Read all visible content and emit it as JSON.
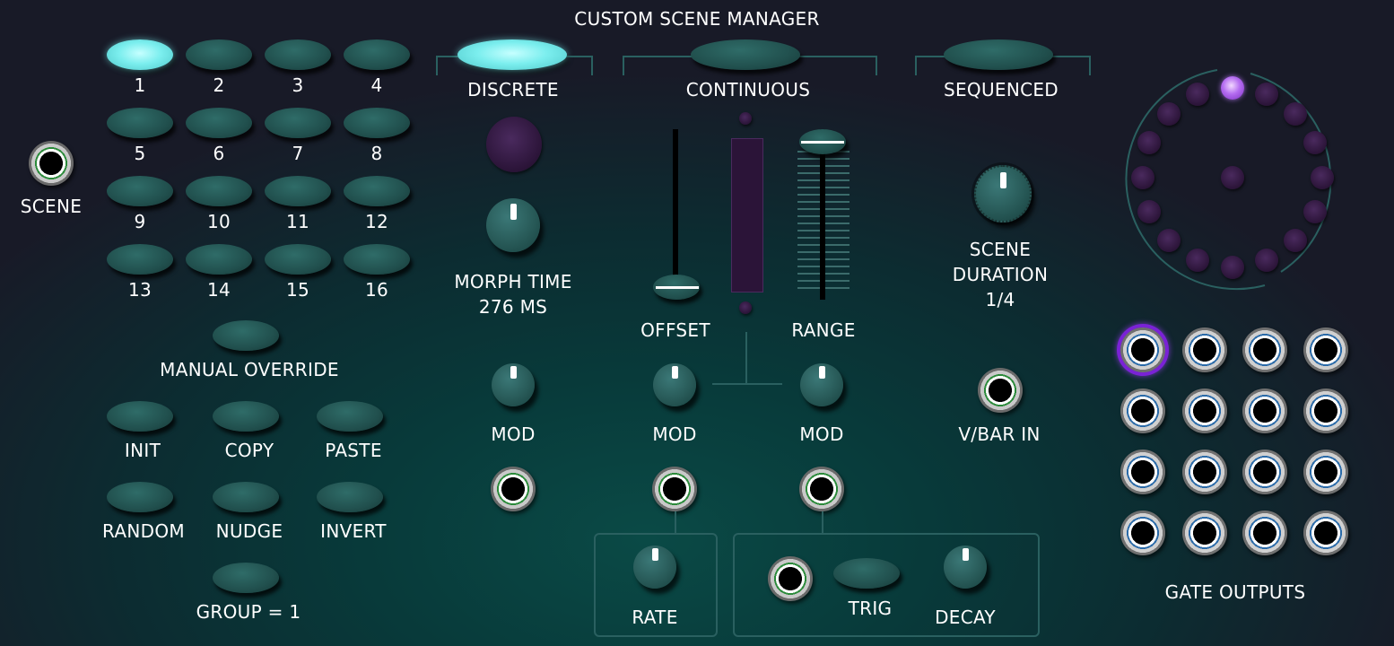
{
  "title": "CUSTOM SCENE MANAGER",
  "scene_input": {
    "label": "SCENE"
  },
  "scenes": {
    "buttons": [
      "1",
      "2",
      "3",
      "4",
      "5",
      "6",
      "7",
      "8",
      "9",
      "10",
      "11",
      "12",
      "13",
      "14",
      "15",
      "16"
    ],
    "active": "1"
  },
  "manual_override": {
    "label": "MANUAL OVERRIDE"
  },
  "actions": {
    "init": "INIT",
    "copy": "COPY",
    "paste": "PASTE",
    "random": "RANDOM",
    "nudge": "NUDGE",
    "invert": "INVERT",
    "group": "GROUP = 1"
  },
  "modes": {
    "discrete": "DISCRETE",
    "continuous": "CONTINUOUS",
    "sequenced": "SEQUENCED",
    "active": "DISCRETE"
  },
  "morph": {
    "label": "MORPH TIME",
    "value": "276 MS"
  },
  "offset": {
    "label": "OFFSET",
    "level": 0.0
  },
  "range": {
    "label": "RANGE",
    "level": 1.0
  },
  "mod_labels": {
    "morph_mod": "MOD",
    "offset_mod": "MOD",
    "range_mod": "MOD"
  },
  "rate": {
    "label": "RATE"
  },
  "trig": {
    "label": "TRIG"
  },
  "decay": {
    "label": "DECAY"
  },
  "scene_duration": {
    "line1": "SCENE",
    "line2": "DURATION",
    "value": "1/4"
  },
  "vbar": {
    "label": "V/BAR IN"
  },
  "gate_outputs": {
    "label": "GATE OUTPUTS",
    "count": 16,
    "selected": 1
  },
  "colors": {
    "accent_cyan": "#7beeee",
    "accent_purple": "#b46cf0",
    "panel": "#083a3a"
  }
}
